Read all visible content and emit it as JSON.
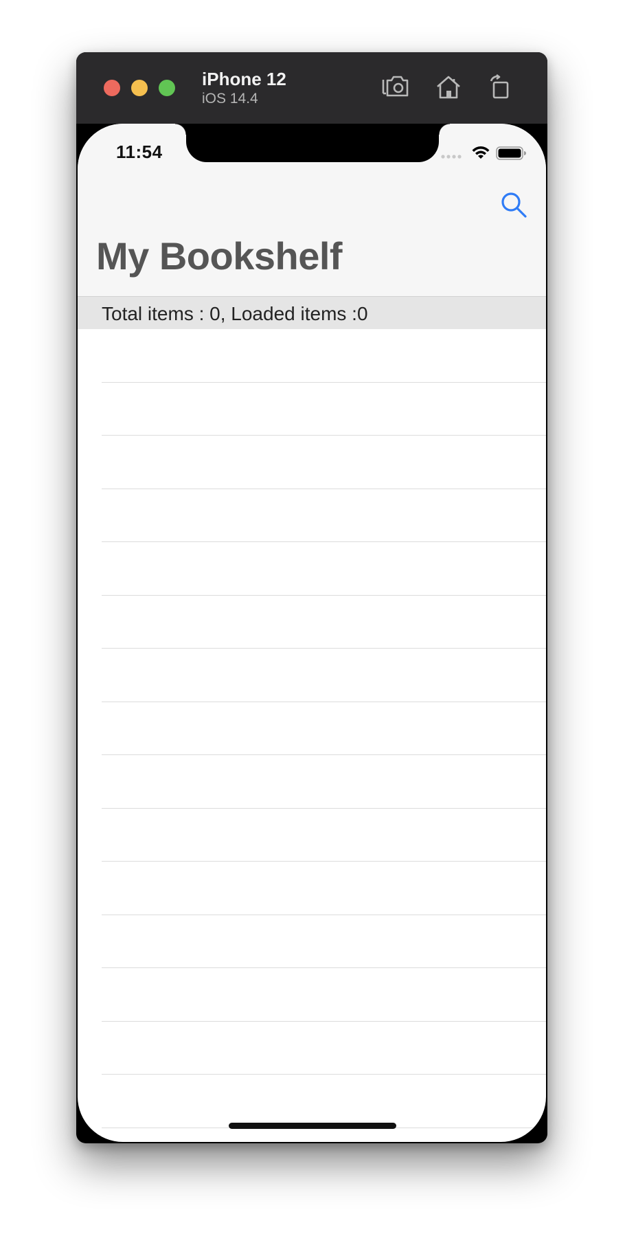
{
  "simulator": {
    "device_name": "iPhone 12",
    "os_version": "iOS 14.4",
    "toolbar": {
      "screenshot_icon": "camera-screenshot-icon",
      "home_icon": "home-icon",
      "rotate_icon": "rotate-icon"
    },
    "traffic_lights": {
      "close_color": "#ed6a5e",
      "minimize_color": "#f5bf4f",
      "zoom_color": "#61c554"
    }
  },
  "status_bar": {
    "time": "11:54",
    "signal_icon": "cellular-signal-icon",
    "wifi_icon": "wifi-icon",
    "battery_icon": "battery-icon"
  },
  "navigation": {
    "title": "My Bookshelf",
    "search_icon": "search-icon",
    "accent_color": "#2f7cf6"
  },
  "list": {
    "header": "Total items : 0, Loaded items :0",
    "rows": [
      "",
      "",
      "",
      "",
      "",
      "",
      "",
      "",
      "",
      "",
      "",
      "",
      "",
      "",
      "",
      ""
    ]
  }
}
